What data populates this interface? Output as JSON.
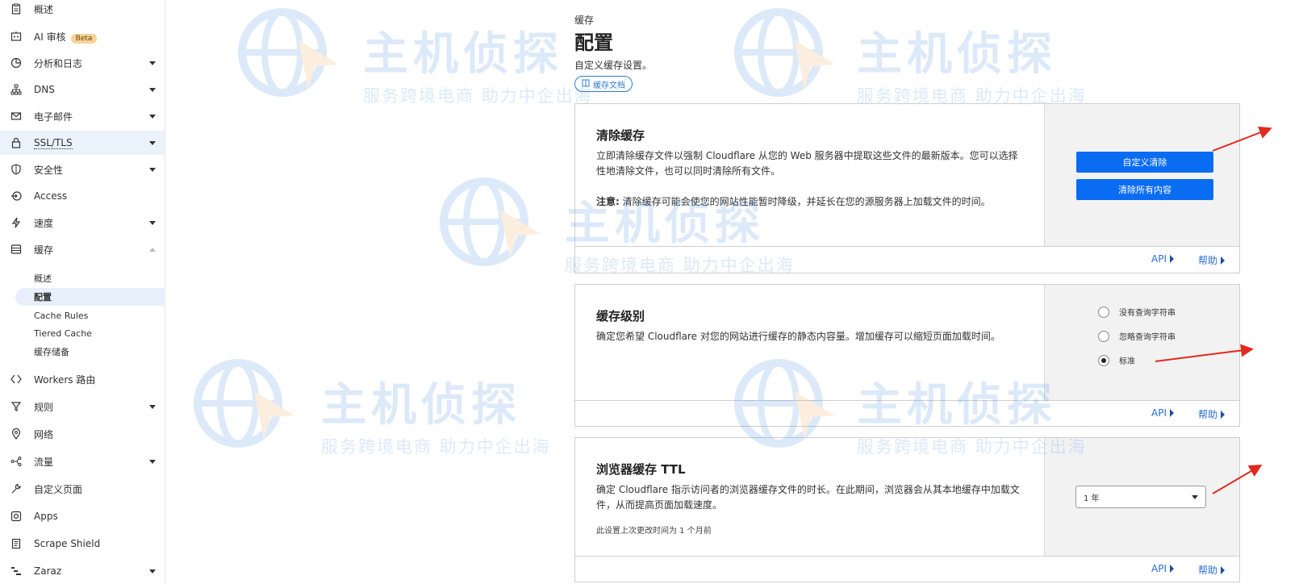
{
  "sidebar": {
    "items": [
      {
        "label": "概述",
        "icon": "clipboard-icon"
      },
      {
        "label": "AI 审核",
        "badge": "Beta",
        "icon": "ai-review-icon"
      },
      {
        "label": "分析和日志",
        "icon": "chart-icon"
      },
      {
        "label": "DNS",
        "icon": "network-icon"
      },
      {
        "label": "电子邮件",
        "icon": "email-icon"
      },
      {
        "label": "SSL/TLS",
        "icon": "lock-icon"
      },
      {
        "label": "安全性",
        "icon": "shield-icon"
      },
      {
        "label": "Access",
        "icon": "access-icon"
      },
      {
        "label": "速度",
        "icon": "lightning-icon"
      },
      {
        "label": "缓存",
        "icon": "cache-icon"
      }
    ],
    "cache_sub": [
      "概述",
      "配置",
      "Cache Rules",
      "Tiered Cache",
      "缓存储备"
    ],
    "items_bottom": [
      {
        "label": "Workers 路由",
        "icon": "workers-icon"
      },
      {
        "label": "规则",
        "icon": "rules-icon"
      },
      {
        "label": "网络",
        "icon": "location-pin-icon"
      },
      {
        "label": "流量",
        "icon": "traffic-icon"
      },
      {
        "label": "自定义页面",
        "icon": "wrench-icon"
      },
      {
        "label": "Apps",
        "icon": "apps-icon"
      },
      {
        "label": "Scrape Shield",
        "icon": "document-icon"
      },
      {
        "label": "Zaraz",
        "icon": "zaraz-icon"
      }
    ]
  },
  "header": {
    "eyebrow": "缓存",
    "title": "配置",
    "description": "自定义缓存设置。",
    "doc_link": "缓存文档"
  },
  "purge": {
    "title": "清除缓存",
    "description": "立即清除缓存文件以强制 Cloudflare 从您的 Web 服务器中提取这些文件的最新版本。您可以选择性地清除文件，也可以同时清除所有文件。",
    "note_label": "注意:",
    "note_text": " 清除缓存可能会使您的网站性能暂时降级，并延长在您的源服务器上加载文件的时间。",
    "custom_button": "自定义清除",
    "all_button": "清除所有内容"
  },
  "cache_level": {
    "title": "缓存级别",
    "description": "确定您希望 Cloudflare 对您的网站进行缓存的静态内容量。增加缓存可以缩短页面加载时间。",
    "options": [
      "没有查询字符串",
      "忽略查询字符串",
      "标准"
    ],
    "selected": "标准"
  },
  "browser_ttl": {
    "title": "浏览器缓存 TTL",
    "description": "确定 Cloudflare 指示访问者的浏览器缓存文件的时长。在此期间，浏览器会从其本地缓存中加载文件，从而提高页面加载速度。",
    "last_changed": "此设置上次更改时间为 1 个月前",
    "value": "1 年"
  },
  "footer_links": {
    "api": "API",
    "help": "帮助"
  },
  "watermark": {
    "line1": "主机侦探",
    "line2": "服务跨境电商 助力中企出海"
  },
  "colors": {
    "accent": "#0a6cf2",
    "link": "#2c6ecf",
    "annotation_arrow": "#e02a1f"
  }
}
